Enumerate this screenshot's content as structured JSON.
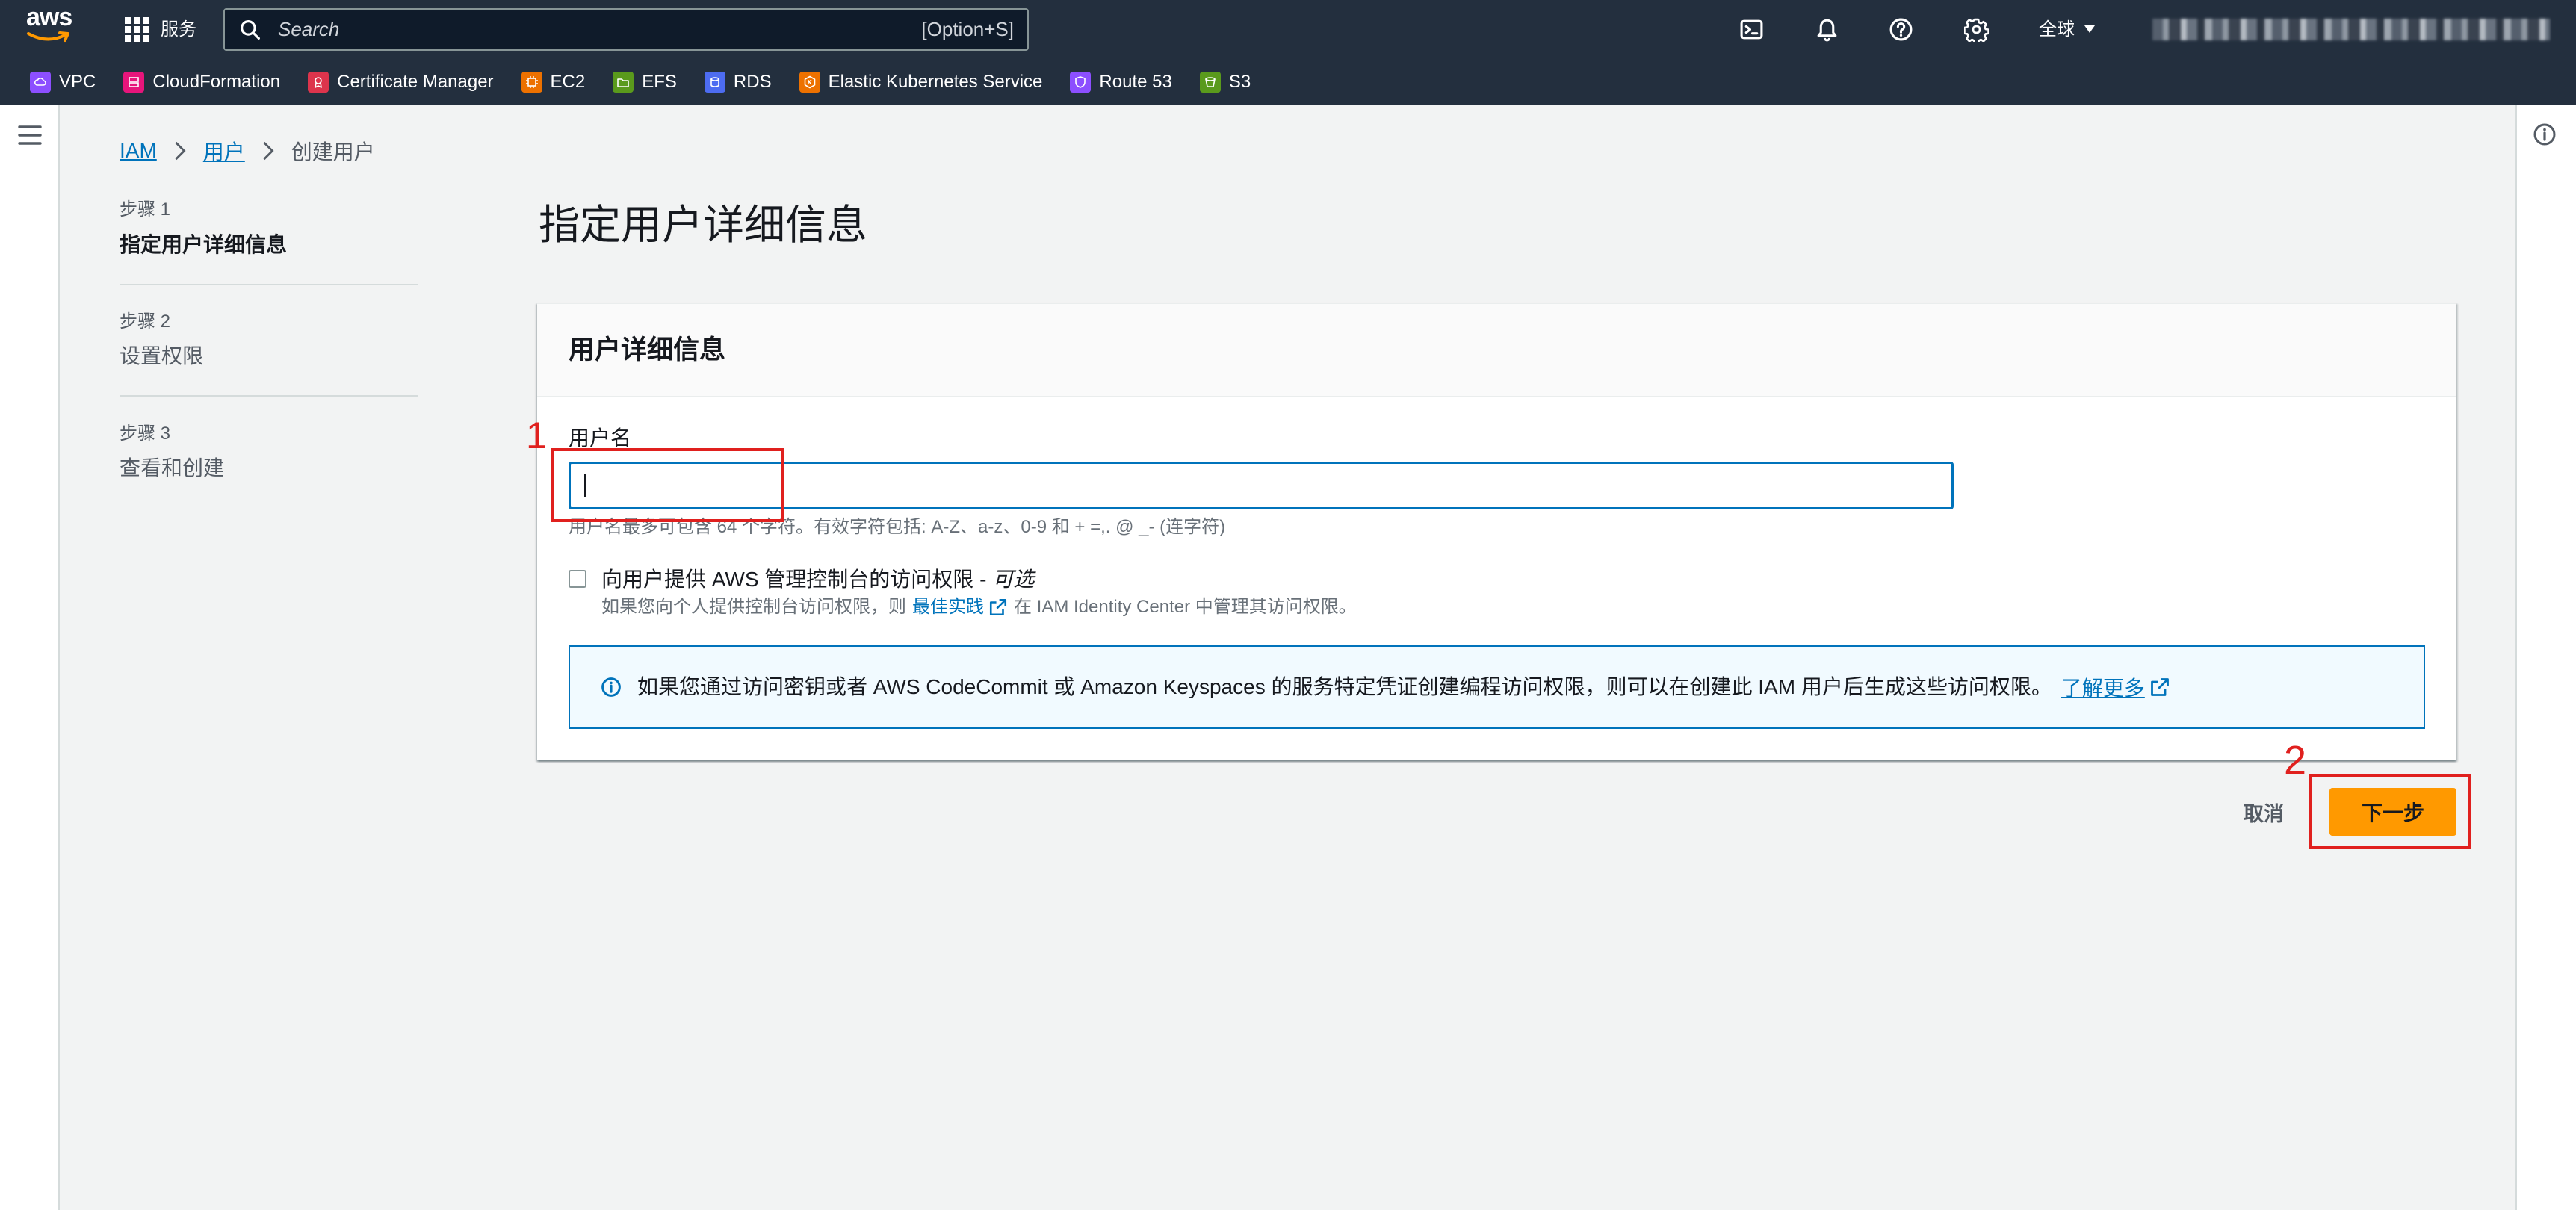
{
  "topbar": {
    "logo_text": "aws",
    "services_label": "服务",
    "search": {
      "placeholder": "Search",
      "shortcut": "[Option+S]"
    },
    "utility_icons": [
      "cloudshell-icon",
      "notifications-icon",
      "help-icon",
      "settings-icon"
    ],
    "region_label": "全球"
  },
  "favorites": [
    {
      "label": "VPC",
      "icon": "vpc-icon",
      "color": "#8c4fff"
    },
    {
      "label": "CloudFormation",
      "icon": "cloudformation-icon",
      "color": "#e7157b"
    },
    {
      "label": "Certificate Manager",
      "icon": "certificate-manager-icon",
      "color": "#dd344c"
    },
    {
      "label": "EC2",
      "icon": "ec2-icon",
      "color": "#ed7100"
    },
    {
      "label": "EFS",
      "icon": "efs-icon",
      "color": "#5a9a1c"
    },
    {
      "label": "RDS",
      "icon": "rds-icon",
      "color": "#4d6cf1"
    },
    {
      "label": "Elastic Kubernetes Service",
      "icon": "eks-icon",
      "color": "#ed7100"
    },
    {
      "label": "Route 53",
      "icon": "route53-icon",
      "color": "#8c4fff"
    },
    {
      "label": "S3",
      "icon": "s3-icon",
      "color": "#5a9a1c"
    }
  ],
  "breadcrumb": [
    {
      "label": "IAM"
    },
    {
      "label": "用户"
    },
    {
      "label": "创建用户"
    }
  ],
  "steps": [
    {
      "label": "步骤 1",
      "title": "指定用户详细信息",
      "current": true
    },
    {
      "label": "步骤 2",
      "title": "设置权限",
      "current": false
    },
    {
      "label": "步骤 3",
      "title": "查看和创建",
      "current": false
    }
  ],
  "page_title": "指定用户详细信息",
  "panel": {
    "title": "用户详细信息",
    "username": {
      "label": "用户名",
      "value": "",
      "hint": "用户名最多可包含 64 个字符。有效字符包括: A-Z、a-z、0-9 和 + =,. @ _- (连字符)"
    },
    "console_access": {
      "label": "向用户提供 AWS 管理控制台的访问权限 -",
      "optional": "可选",
      "checked": false,
      "description_before": "如果您向个人提供控制台访问权限，则",
      "link": "最佳实践",
      "description_after": "在 IAM Identity Center 中管理其访问权限。"
    },
    "alert": {
      "icon": "info-icon",
      "text": "如果您通过访问密钥或者 AWS CodeCommit 或 Amazon Keyspaces 的服务特定凭证创建编程访问权限，则可以在创建此 IAM 用户后生成这些访问权限。",
      "link": "了解更多"
    }
  },
  "actions": {
    "cancel": "取消",
    "next": "下一步"
  },
  "annotations": [
    {
      "label": "1"
    },
    {
      "label": "2"
    }
  ],
  "colors": {
    "nav_bg": "#232f3e",
    "content_bg": "#f2f3f3",
    "link": "#0073bb",
    "primary_button": "#ff9900",
    "alert_bg": "#f1faff",
    "annotation": "#e0201e"
  }
}
